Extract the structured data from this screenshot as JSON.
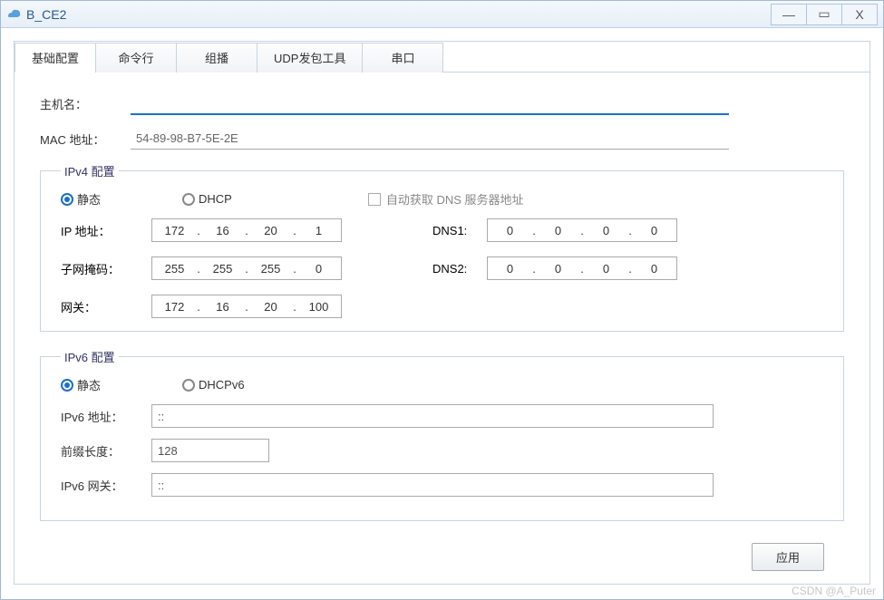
{
  "window": {
    "title": "B_CE2"
  },
  "tabs": [
    "基础配置",
    "命令行",
    "组播",
    "UDP发包工具",
    "串口"
  ],
  "basic": {
    "hostname_label": "主机名：",
    "hostname_value": "",
    "mac_label": "MAC 地址：",
    "mac_value": "54-89-98-B7-5E-2E"
  },
  "ipv4": {
    "legend": "IPv4 配置",
    "radio_static": "静态",
    "radio_dhcp": "DHCP",
    "auto_dns": "自动获取 DNS 服务器地址",
    "ip_label": "IP 地址：",
    "ip_value": [
      "172",
      "16",
      "20",
      "1"
    ],
    "mask_label": "子网掩码：",
    "mask_value": [
      "255",
      "255",
      "255",
      "0"
    ],
    "gw_label": "网关：",
    "gw_value": [
      "172",
      "16",
      "20",
      "100"
    ],
    "dns1_label": "DNS1:",
    "dns1_value": [
      "0",
      "0",
      "0",
      "0"
    ],
    "dns2_label": "DNS2:",
    "dns2_value": [
      "0",
      "0",
      "0",
      "0"
    ]
  },
  "ipv6": {
    "legend": "IPv6 配置",
    "radio_static": "静态",
    "radio_dhcpv6": "DHCPv6",
    "addr_label": "IPv6 地址：",
    "addr_value": "::",
    "prefix_label": "前缀长度：",
    "prefix_value": "128",
    "gw_label": "IPv6 网关：",
    "gw_value": "::"
  },
  "footer": {
    "apply": "应用"
  },
  "watermark": "CSDN @A_Puter"
}
